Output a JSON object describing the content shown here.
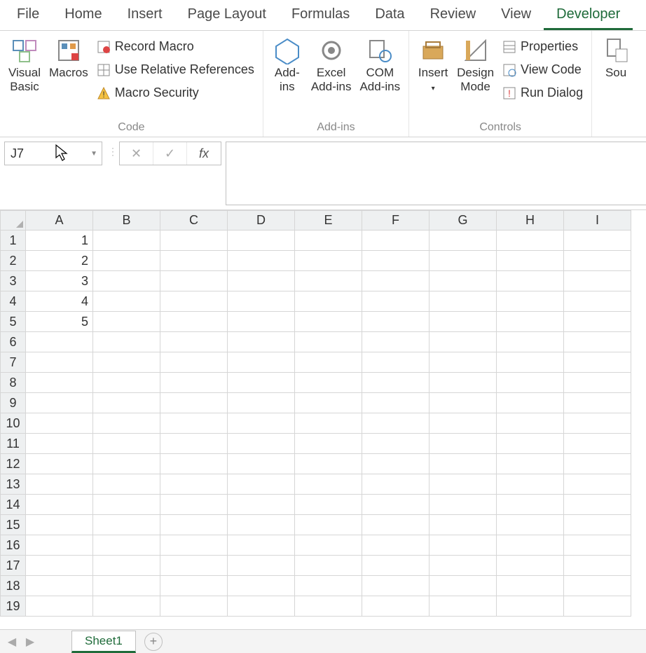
{
  "tabs": [
    "File",
    "Home",
    "Insert",
    "Page Layout",
    "Formulas",
    "Data",
    "Review",
    "View",
    "Developer"
  ],
  "active_tab": "Developer",
  "ribbon": {
    "code": {
      "visual_basic": "Visual\nBasic",
      "macros": "Macros",
      "record_macro": "Record Macro",
      "use_relative": "Use Relative References",
      "macro_security": "Macro Security",
      "group_label": "Code"
    },
    "addins": {
      "addins": "Add-\nins",
      "excel_addins": "Excel\nAdd-ins",
      "com_addins": "COM\nAdd-ins",
      "group_label": "Add-ins"
    },
    "controls": {
      "insert": "Insert",
      "design_mode": "Design\nMode",
      "properties": "Properties",
      "view_code": "View Code",
      "run_dialog": "Run Dialog",
      "group_label": "Controls"
    },
    "xml": {
      "source": "Sou"
    }
  },
  "namebox": "J7",
  "fx_label": "fx",
  "columns": [
    "A",
    "B",
    "C",
    "D",
    "E",
    "F",
    "G",
    "H",
    "I"
  ],
  "rows": 19,
  "cells": {
    "A1": "1",
    "A2": "2",
    "A3": "3",
    "A4": "4",
    "A5": "5"
  },
  "sheet_tab": "Sheet1"
}
